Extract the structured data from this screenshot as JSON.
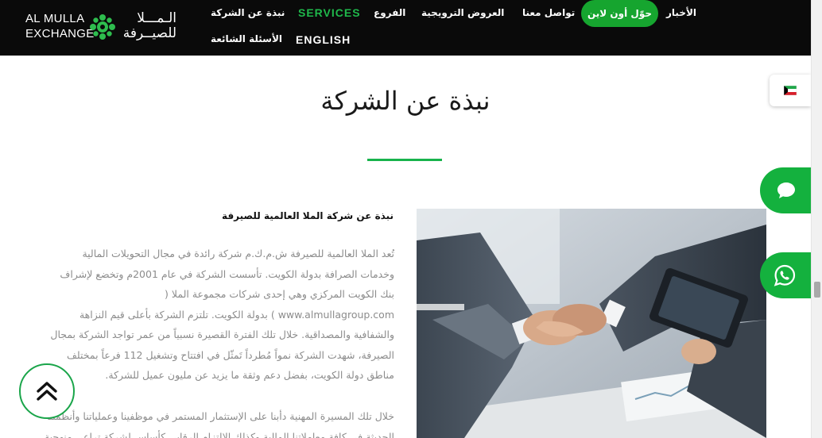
{
  "brand": {
    "en_line1": "AL MULLA",
    "en_line2": "EXCHANGE",
    "ar_line1": "الـمـــلا",
    "ar_line2": "للصيــرفة"
  },
  "nav": {
    "row1": {
      "about": "نبذة عن الشركة",
      "services": "SERVICES",
      "branches": "الفروع",
      "promotions": "العروض الترويجية",
      "contact": "تواصل معنا",
      "transfer_online": "حوّل أون لاين",
      "news": "الأخبار"
    },
    "row2": {
      "faq": "الأسئلة الشائعة",
      "english": "ENGLISH"
    }
  },
  "page": {
    "title": "نبذة عن الشركة",
    "section_heading": "نبذة عن شركة الملا العالمية للصيرفة",
    "paragraph1": "تُعد الملا العالمية للصيرفة ش.م.ك.م شركة رائدة في مجال التحويلات المالية وخدمات الصرافة بدولة الكويت. تأسست الشركة في عام 2001م وتخضع لإشراف بنك الكويت المركزي وهي إحدى شركات مجموعة الملا ( www.almullagroup.com ) بدولة الكويت. تلتزم الشركة بأعلى قيم النزاهة والشفافية والمصداقية. خلال تلك الفترة القصيرة نسبياً من عمر تواجد الشركة بمجال الصيرفة، شهدت الشركة نمواً مُطرداً تَمثّل في افتتاح وتشغيل 112 فرعاً بمختلف مناطق دولة الكويت، بفضل دعم وثقة ما يزيد عن مليون عميل للشركة.",
    "paragraph2_line1": "خلال تلك المسيرة المهنية دأبنا على الإستثمار المستمر في موظفينا وعملياتنا وأنظمتنا",
    "paragraph2_line2": "الحديثة في كافة معاملاتنا المالية وكذلك الإلتزام الرقابي كأساس لشركة تراعي منهجية"
  },
  "icons": {
    "flag": "kuwait-flag-icon",
    "chat": "chat-bubble-icon",
    "whatsapp": "whatsapp-icon",
    "scroll_top": "double-chevron-up-icon"
  },
  "colors": {
    "header_bg": "#0a0a0a",
    "accent_green": "#16a52f",
    "services_green": "#1fb84b",
    "body_text": "#8c8c8c"
  }
}
